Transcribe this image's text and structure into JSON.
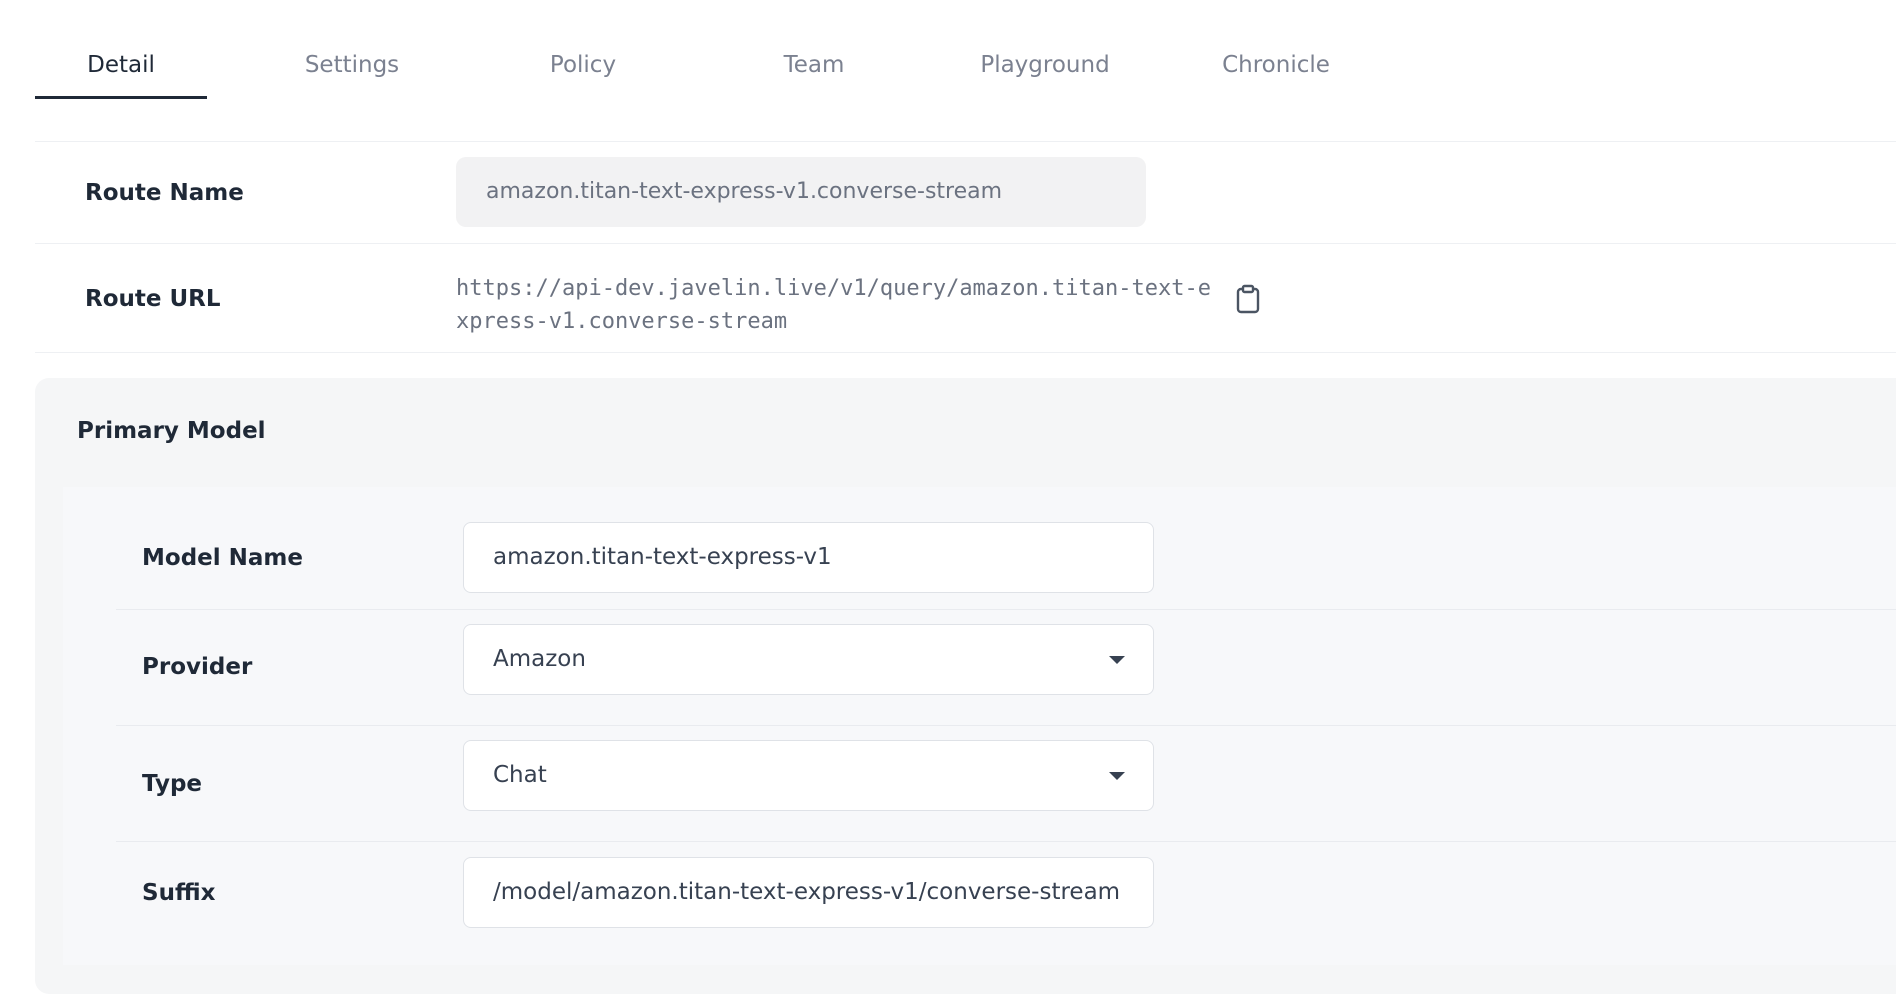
{
  "tabs": [
    {
      "label": "Detail",
      "active": true
    },
    {
      "label": "Settings",
      "active": false
    },
    {
      "label": "Policy",
      "active": false
    },
    {
      "label": "Team",
      "active": false
    },
    {
      "label": "Playground",
      "active": false
    },
    {
      "label": "Chronicle",
      "active": false
    }
  ],
  "route": {
    "name_label": "Route Name",
    "name_value": "amazon.titan-text-express-v1.converse-stream",
    "url_label": "Route URL",
    "url_value": "https://api-dev.javelin.live/v1/query/amazon.titan-text-express-v1.converse-stream",
    "copy_icon": "clipboard-icon"
  },
  "primary_model": {
    "title": "Primary Model",
    "model_name_label": "Model Name",
    "model_name_value": "amazon.titan-text-express-v1",
    "provider_label": "Provider",
    "provider_value": "Amazon",
    "type_label": "Type",
    "type_value": "Chat",
    "suffix_label": "Suffix",
    "suffix_value": "/model/amazon.titan-text-express-v1/converse-stream"
  },
  "colors": {
    "active_tab": "#1f2937",
    "inactive_tab": "#7b8190",
    "card_bg": "#f5f6f7"
  }
}
